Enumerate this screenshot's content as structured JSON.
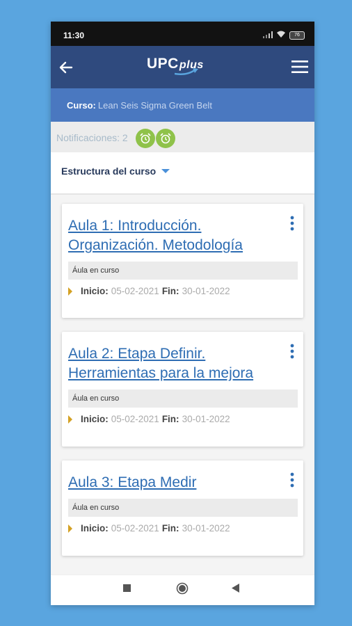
{
  "status_bar": {
    "time": "11:30",
    "battery": "76"
  },
  "app_bar": {
    "logo_main": "UPC",
    "logo_plus": "plus"
  },
  "course": {
    "label": "Curso:",
    "name": "Lean Seis Sigma Green Belt"
  },
  "notifications": {
    "text": "Notificaciones: 2"
  },
  "structure": {
    "label": "Estructura del curso"
  },
  "cards": [
    {
      "title": "Aula 1: Introducción. Organización. Metodología",
      "status": "Áula en curso",
      "start_label": "Inicio:",
      "start": "05-02-2021",
      "end_label": "Fin:",
      "end": "30-01-2022"
    },
    {
      "title": "Aula 2: Etapa Definir. Herramientas para la mejora",
      "status": "Áula en curso",
      "start_label": "Inicio:",
      "start": "05-02-2021",
      "end_label": "Fin:",
      "end": "30-01-2022"
    },
    {
      "title": "Aula 3: Etapa Medir",
      "status": "Áula en curso",
      "start_label": "Inicio:",
      "start": "05-02-2021",
      "end_label": "Fin:",
      "end": "30-01-2022"
    }
  ],
  "colors": {
    "background": "#5aa5df",
    "app_bar": "#2f4a7e",
    "course_bar": "#4a78c0",
    "link": "#2e6db3",
    "alarm": "#8fc24a"
  }
}
